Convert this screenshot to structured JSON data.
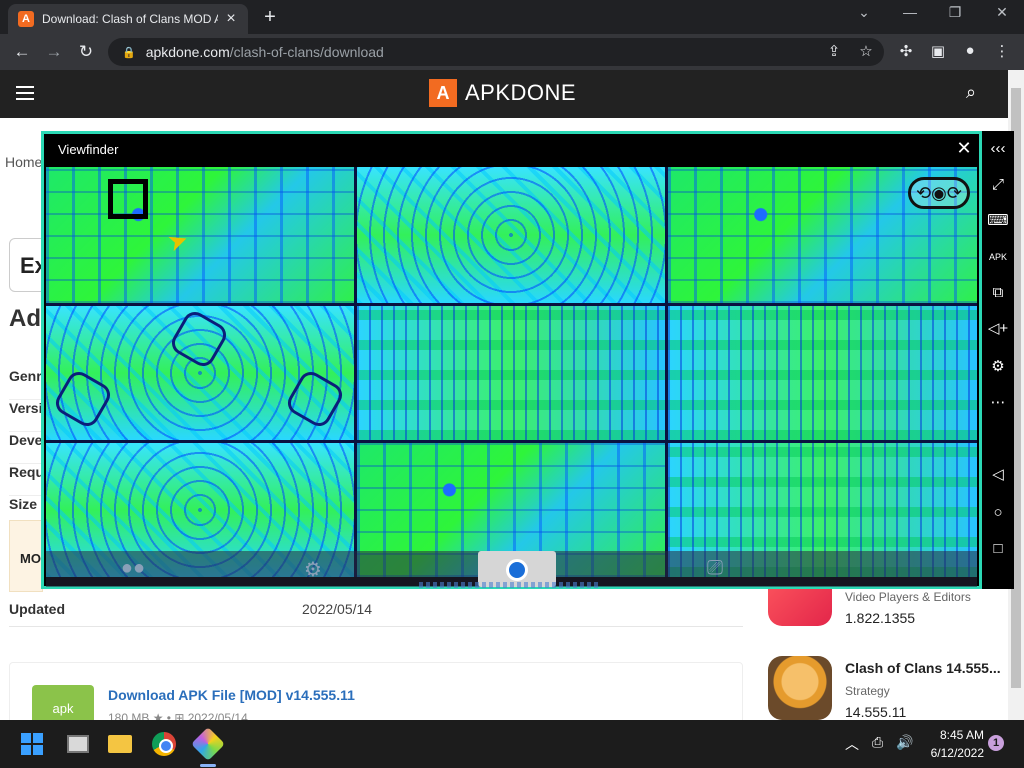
{
  "browser": {
    "tab_title": "Download: Clash of Clans MOD A",
    "tab_favicon": "A",
    "url_domain": "apkdone.com",
    "url_path": "/clash-of-clans/download"
  },
  "site": {
    "logo_mark": "A",
    "logo_text": "APKDONE",
    "accent_color": "#f26b21"
  },
  "page": {
    "breadcrumb": "Home",
    "search_partial": "Ex",
    "heading_partial": "Ad",
    "info_labels": [
      "Genr",
      "Versi",
      "Deve",
      "Requ",
      "Size"
    ],
    "mod_label": "MO",
    "updated_label": "Updated",
    "updated_value": "2022/05/14",
    "download": {
      "icon_label": "apk",
      "title": "Download APK File [MOD] v14.555.11",
      "meta": "180 MB ★ • ⊞ 2022/05/14"
    }
  },
  "sidebar_apps": [
    {
      "name": "",
      "category": "Video Players & Editors",
      "version": "1.822.1355"
    },
    {
      "name": "Clash of Clans 14.555...",
      "category": "Strategy",
      "version": "14.555.11"
    }
  ],
  "viewfinder": {
    "title": "Viewfinder",
    "close_glyph": "✕",
    "frame_color": "#2bd9b5"
  },
  "emulator_toolbar": {
    "icons": [
      "collapse-icon",
      "fullscreen-icon",
      "keyboard-icon",
      "apk-icon",
      "multi-instance-icon",
      "volume-icon",
      "settings-icon",
      "more-icon",
      "back-icon",
      "home-icon",
      "recents-icon"
    ]
  },
  "taskbar": {
    "time": "8:45 AM",
    "date": "6/12/2022",
    "notification_count": "1"
  }
}
